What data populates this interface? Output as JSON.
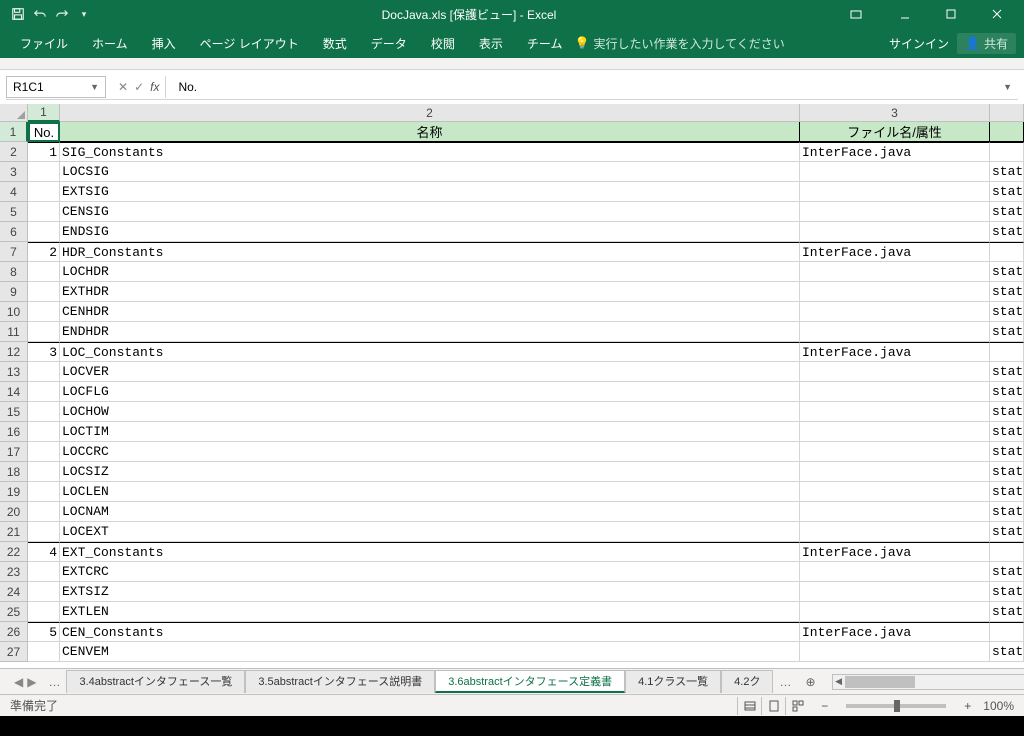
{
  "title": "DocJava.xls  [保護ビュー] - Excel",
  "ribbon": {
    "tabs": [
      "ファイル",
      "ホーム",
      "挿入",
      "ページ レイアウト",
      "数式",
      "データ",
      "校閲",
      "表示",
      "チーム"
    ],
    "tellme": "実行したい作業を入力してください",
    "signin": "サインイン",
    "share": "共有"
  },
  "name_box": "R1C1",
  "formula": "No.",
  "col_headers": [
    "1",
    "2",
    "3"
  ],
  "header_row": {
    "c1": "No.",
    "c2": "名称",
    "c3": "ファイル名/属性",
    "c4": ""
  },
  "rows": [
    {
      "rn": 2,
      "no": "1",
      "name": "SIG_Constants",
      "file": "InterFace.java",
      "attr": "",
      "top": true
    },
    {
      "rn": 3,
      "no": "",
      "name": "LOCSIG",
      "file": "",
      "attr": "stati"
    },
    {
      "rn": 4,
      "no": "",
      "name": "EXTSIG",
      "file": "",
      "attr": "stati"
    },
    {
      "rn": 5,
      "no": "",
      "name": "CENSIG",
      "file": "",
      "attr": "stati"
    },
    {
      "rn": 6,
      "no": "",
      "name": "ENDSIG",
      "file": "",
      "attr": "stati"
    },
    {
      "rn": 7,
      "no": "2",
      "name": "HDR_Constants",
      "file": "InterFace.java",
      "attr": "",
      "top": true
    },
    {
      "rn": 8,
      "no": "",
      "name": "LOCHDR",
      "file": "",
      "attr": "stati"
    },
    {
      "rn": 9,
      "no": "",
      "name": "EXTHDR",
      "file": "",
      "attr": "stati"
    },
    {
      "rn": 10,
      "no": "",
      "name": "CENHDR",
      "file": "",
      "attr": "stati"
    },
    {
      "rn": 11,
      "no": "",
      "name": "ENDHDR",
      "file": "",
      "attr": "stati"
    },
    {
      "rn": 12,
      "no": "3",
      "name": "LOC_Constants",
      "file": "InterFace.java",
      "attr": "",
      "top": true
    },
    {
      "rn": 13,
      "no": "",
      "name": "LOCVER",
      "file": "",
      "attr": "stati"
    },
    {
      "rn": 14,
      "no": "",
      "name": "LOCFLG",
      "file": "",
      "attr": "stati"
    },
    {
      "rn": 15,
      "no": "",
      "name": "LOCHOW",
      "file": "",
      "attr": "stati"
    },
    {
      "rn": 16,
      "no": "",
      "name": "LOCTIM",
      "file": "",
      "attr": "stati"
    },
    {
      "rn": 17,
      "no": "",
      "name": "LOCCRC",
      "file": "",
      "attr": "stati"
    },
    {
      "rn": 18,
      "no": "",
      "name": "LOCSIZ",
      "file": "",
      "attr": "stati"
    },
    {
      "rn": 19,
      "no": "",
      "name": "LOCLEN",
      "file": "",
      "attr": "stati"
    },
    {
      "rn": 20,
      "no": "",
      "name": "LOCNAM",
      "file": "",
      "attr": "stati"
    },
    {
      "rn": 21,
      "no": "",
      "name": "LOCEXT",
      "file": "",
      "attr": "stati"
    },
    {
      "rn": 22,
      "no": "4",
      "name": "EXT_Constants",
      "file": "InterFace.java",
      "attr": "",
      "top": true
    },
    {
      "rn": 23,
      "no": "",
      "name": "EXTCRC",
      "file": "",
      "attr": "stati"
    },
    {
      "rn": 24,
      "no": "",
      "name": "EXTSIZ",
      "file": "",
      "attr": "stati"
    },
    {
      "rn": 25,
      "no": "",
      "name": "EXTLEN",
      "file": "",
      "attr": "stati"
    },
    {
      "rn": 26,
      "no": "5",
      "name": "CEN_Constants",
      "file": "InterFace.java",
      "attr": "",
      "top": true
    },
    {
      "rn": 27,
      "no": "",
      "name": "CENVEM",
      "file": "",
      "attr": "stati"
    }
  ],
  "sheets": {
    "ellipsis": "…",
    "items": [
      {
        "label": "3.4abstractインタフェース一覧",
        "active": false
      },
      {
        "label": "3.5abstractインタフェース説明書",
        "active": false
      },
      {
        "label": "3.6abstractインタフェース定義書",
        "active": true
      },
      {
        "label": "4.1クラス一覧",
        "active": false
      },
      {
        "label": "4.2ク",
        "active": false
      }
    ],
    "trail": "…"
  },
  "status": {
    "ready": "準備完了",
    "zoom": "100%",
    "zminus": "−",
    "zplus": "+"
  }
}
